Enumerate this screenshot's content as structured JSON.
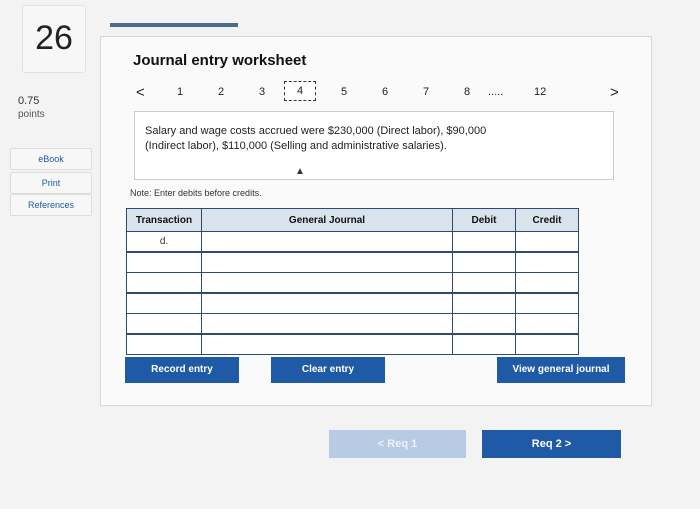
{
  "question": {
    "number": "26",
    "points_value": "0.75",
    "points_label": "points"
  },
  "sidebar": {
    "ebook": "eBook",
    "print": "Print",
    "references": "References"
  },
  "worksheet": {
    "title": "Journal entry worksheet",
    "prev_arrow": "<",
    "next_arrow": ">",
    "tabs": [
      "1",
      "2",
      "3",
      "4",
      "5",
      "6",
      "7",
      "8",
      ".....",
      "12"
    ],
    "active_tab": "4",
    "prompt_line1": "Salary and wage costs accrued were $230,000 (Direct labor), $90,000",
    "prompt_line2": "(Indirect labor), $110,000 (Selling and administrative salaries).",
    "note": "Note: Enter debits before credits."
  },
  "table": {
    "headers": [
      "Transaction",
      "General Journal",
      "Debit",
      "Credit"
    ],
    "rows": [
      {
        "transaction": "d.",
        "account": "",
        "debit": "",
        "credit": ""
      },
      {
        "transaction": "",
        "account": "",
        "debit": "",
        "credit": ""
      },
      {
        "transaction": "",
        "account": "",
        "debit": "",
        "credit": ""
      },
      {
        "transaction": "",
        "account": "",
        "debit": "",
        "credit": ""
      },
      {
        "transaction": "",
        "account": "",
        "debit": "",
        "credit": ""
      },
      {
        "transaction": "",
        "account": "",
        "debit": "",
        "credit": ""
      }
    ]
  },
  "buttons": {
    "record_entry": "Record entry",
    "clear_entry": "Clear entry",
    "view_general_journal": "View general journal",
    "req1": "< Req 1",
    "req2": "Req 2 >"
  },
  "colors": {
    "accent": "#1f5aa6",
    "header_fill": "#d9e3ee",
    "disabled": "#b7cbe4"
  }
}
